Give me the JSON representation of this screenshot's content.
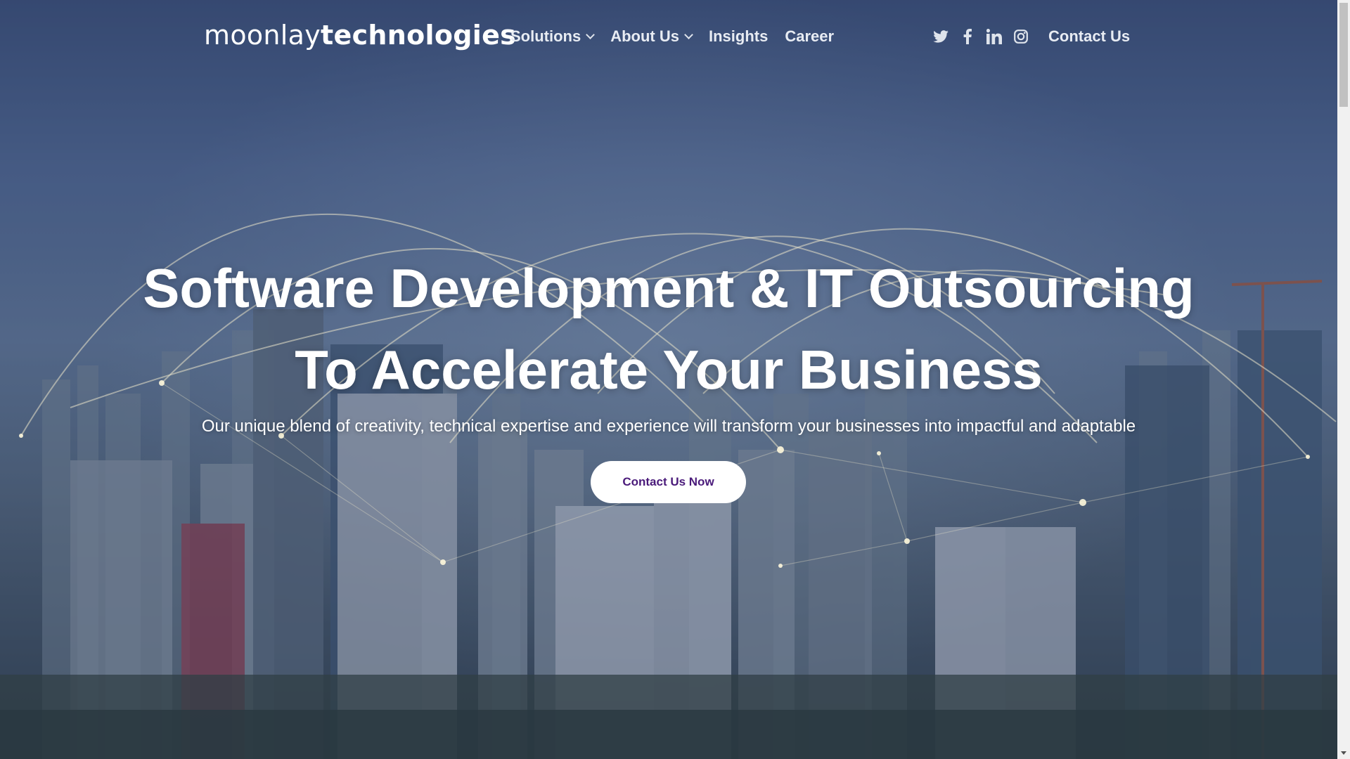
{
  "header": {
    "logo_light": "moonlay",
    "logo_bold": "technologies",
    "nav": [
      {
        "label": "Solutions",
        "has_dropdown": true
      },
      {
        "label": "About Us",
        "has_dropdown": true
      },
      {
        "label": "Insights",
        "has_dropdown": false
      },
      {
        "label": "Career",
        "has_dropdown": false
      }
    ],
    "social_icons": [
      "twitter-icon",
      "facebook-icon",
      "linkedin-icon",
      "instagram-icon"
    ],
    "contact_label": "Contact Us"
  },
  "hero": {
    "title_line1": "Software Development & IT Outsourcing",
    "title_line2": "To Accelerate Your Business",
    "subtitle": "Our unique blend of creativity, technical expertise and experience will transform your businesses into impactful and adaptable",
    "cta_label": "Contact Us Now"
  },
  "colors": {
    "cta_text": "#4a1a7a",
    "nav_text": "#e8ecf3",
    "overlay": "#34466e"
  }
}
